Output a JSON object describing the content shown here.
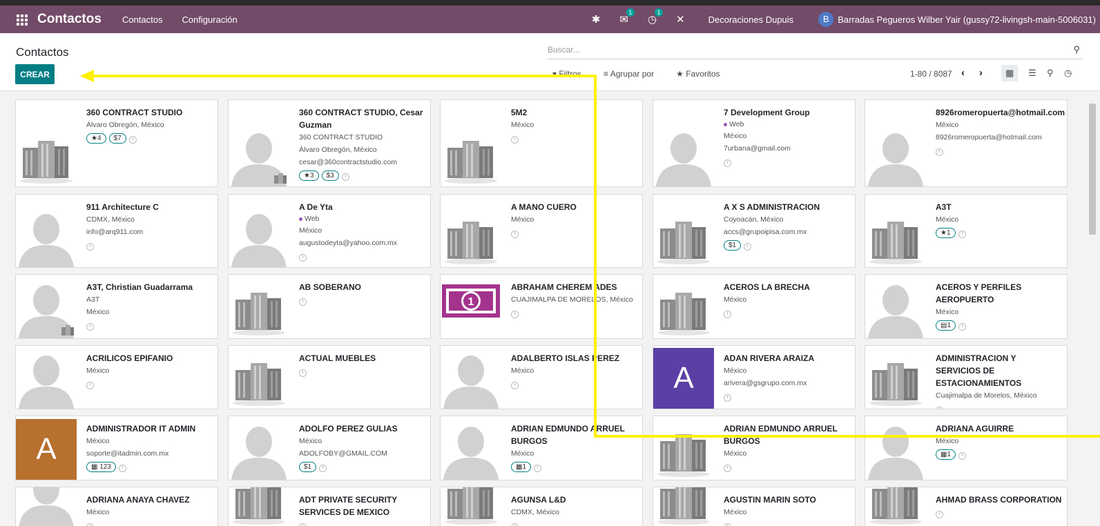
{
  "app": {
    "brand": "Contactos",
    "menu": [
      "Contactos",
      "Configuración"
    ],
    "company": "Decoraciones Dupuis",
    "user_initial": "B",
    "user": "Barradas Pegueros Wilber Yair (gussy72-livingsh-main-5006031)",
    "messages_badge": "1",
    "activities_badge": "1",
    "icons": [
      "apps-grid-icon",
      "bug-icon",
      "chat-icon",
      "activity-icon",
      "close-icon"
    ]
  },
  "control": {
    "breadcrumb": "Contactos",
    "create_label": "CREAR",
    "search_placeholder": "Buscar...",
    "filters_label": "Filtros",
    "groupby_label": "Agrupar por",
    "favorites_label": "Favoritos",
    "pager": "1-80 / 8087"
  },
  "colors": {
    "navbar": "#714B67",
    "primary": "#017E84",
    "annotation_arrow": "#FFEF00"
  },
  "cards": [
    {
      "name": "360 CONTRACT STUDIO",
      "lines": [
        "Álvaro Obregón, México"
      ],
      "badges": [
        "★4",
        "$7"
      ],
      "img": "company"
    },
    {
      "name": "360 CONTRACT STUDIO, Cesar Guzman",
      "lines": [
        "360 CONTRACT STUDIO",
        "Álvaro Obregón, México",
        "cesar@360contractstudio.com"
      ],
      "badges": [
        "★3",
        "$3"
      ],
      "img": "person-sub"
    },
    {
      "name": "5M2",
      "lines": [
        "México"
      ],
      "badges": [],
      "img": "company"
    },
    {
      "name": "7 Development Group",
      "tag": "Web",
      "lines": [
        "México",
        "7urbana@gmail.com"
      ],
      "badges": [],
      "img": "person"
    },
    {
      "name": "8926romeropuerta@hotmail.com",
      "lines": [
        "México",
        "8926romeropuerta@hotmail.com"
      ],
      "badges": [],
      "img": "person"
    },
    {
      "name": "911 Architecture C",
      "lines": [
        "CDMX, México",
        "info@arq911.com"
      ],
      "badges": [],
      "img": "person"
    },
    {
      "name": "A De Yta",
      "tag": "Web",
      "lines": [
        "México",
        "augustodeyta@yahoo.com.mx"
      ],
      "badges": [],
      "img": "person"
    },
    {
      "name": "A MANO CUERO",
      "lines": [
        "México"
      ],
      "badges": [],
      "img": "company"
    },
    {
      "name": "A X S ADMINISTRACION",
      "lines": [
        "Coyoacán, México",
        "accs@grupoipisa.com.mx"
      ],
      "badges": [
        "$1"
      ],
      "img": "company"
    },
    {
      "name": "A3T",
      "lines": [
        "México"
      ],
      "badges": [
        "★1"
      ],
      "img": "company"
    },
    {
      "name": "A3T, Christian Guadarrama",
      "lines": [
        "A3T",
        "México"
      ],
      "badges": [],
      "img": "person-sub"
    },
    {
      "name": "AB SOBERANO",
      "lines": [],
      "badges": [],
      "img": "company"
    },
    {
      "name": "ABRAHAM CHEREM ADES",
      "lines": [
        "CUAJIMALPA DE MORELOS, México"
      ],
      "badges": [],
      "img": "money"
    },
    {
      "name": "ACEROS LA BRECHA",
      "lines": [
        "México"
      ],
      "badges": [],
      "img": "company"
    },
    {
      "name": "ACEROS Y PERFILES AEROPUERTO",
      "lines": [
        "México"
      ],
      "badges": [
        "▤1"
      ],
      "img": "person"
    },
    {
      "name": "ACRILICOS EPIFANIO",
      "lines": [
        "México"
      ],
      "badges": [],
      "img": "person"
    },
    {
      "name": "ACTUAL MUEBLES",
      "lines": [],
      "badges": [],
      "img": "company"
    },
    {
      "name": "ADALBERTO ISLAS PEREZ",
      "lines": [
        "México"
      ],
      "badges": [],
      "img": "person"
    },
    {
      "name": "ADAN RIVERA ARAIZA",
      "lines": [
        "México",
        "arivera@gsgrupo.com.mx"
      ],
      "badges": [],
      "img": "letter-purple"
    },
    {
      "name": "ADMINISTRACION Y SERVICIOS DE ESTACIONAMIENTOS",
      "lines": [
        "Cuajimalpa de Morelos, México"
      ],
      "badges": [],
      "img": "company"
    },
    {
      "name": "ADMINISTRADOR IT ADMIN",
      "lines": [
        "México",
        "soporte@itadmin.com.mx"
      ],
      "badges": [
        "▦ 123"
      ],
      "img": "letter-orange"
    },
    {
      "name": "ADOLFO PEREZ GULIAS",
      "lines": [
        "México",
        "ADOLFOBY@GMAIL.COM"
      ],
      "badges": [
        "$1"
      ],
      "img": "person"
    },
    {
      "name": "ADRIAN EDMUNDO ARRUEL BURGOS",
      "lines": [
        "México"
      ],
      "badges": [
        "▦1"
      ],
      "img": "person"
    },
    {
      "name": "ADRIAN EDMUNDO ARRUEL BURGOS",
      "lines": [
        "México"
      ],
      "badges": [],
      "img": "company"
    },
    {
      "name": "ADRIANA AGUIRRE",
      "lines": [
        "México"
      ],
      "badges": [
        "▦1"
      ],
      "img": "person"
    },
    {
      "name": "ADRIANA ANAYA CHAVEZ",
      "lines": [
        "México"
      ],
      "badges": [],
      "img": "person"
    },
    {
      "name": "ADT PRIVATE SECURITY SERVICES DE MEXICO",
      "lines": [],
      "badges": [],
      "img": "company"
    },
    {
      "name": "AGUNSA L&D",
      "lines": [
        "CDMX, México"
      ],
      "badges": [],
      "img": "company"
    },
    {
      "name": "AGUSTIN MARIN SOTO",
      "lines": [
        "México"
      ],
      "badges": [],
      "img": "company"
    },
    {
      "name": "AHMAD BRASS CORPORATION",
      "lines": [],
      "badges": [],
      "img": "company"
    }
  ],
  "letters": {
    "purple": "A",
    "orange": "A"
  }
}
